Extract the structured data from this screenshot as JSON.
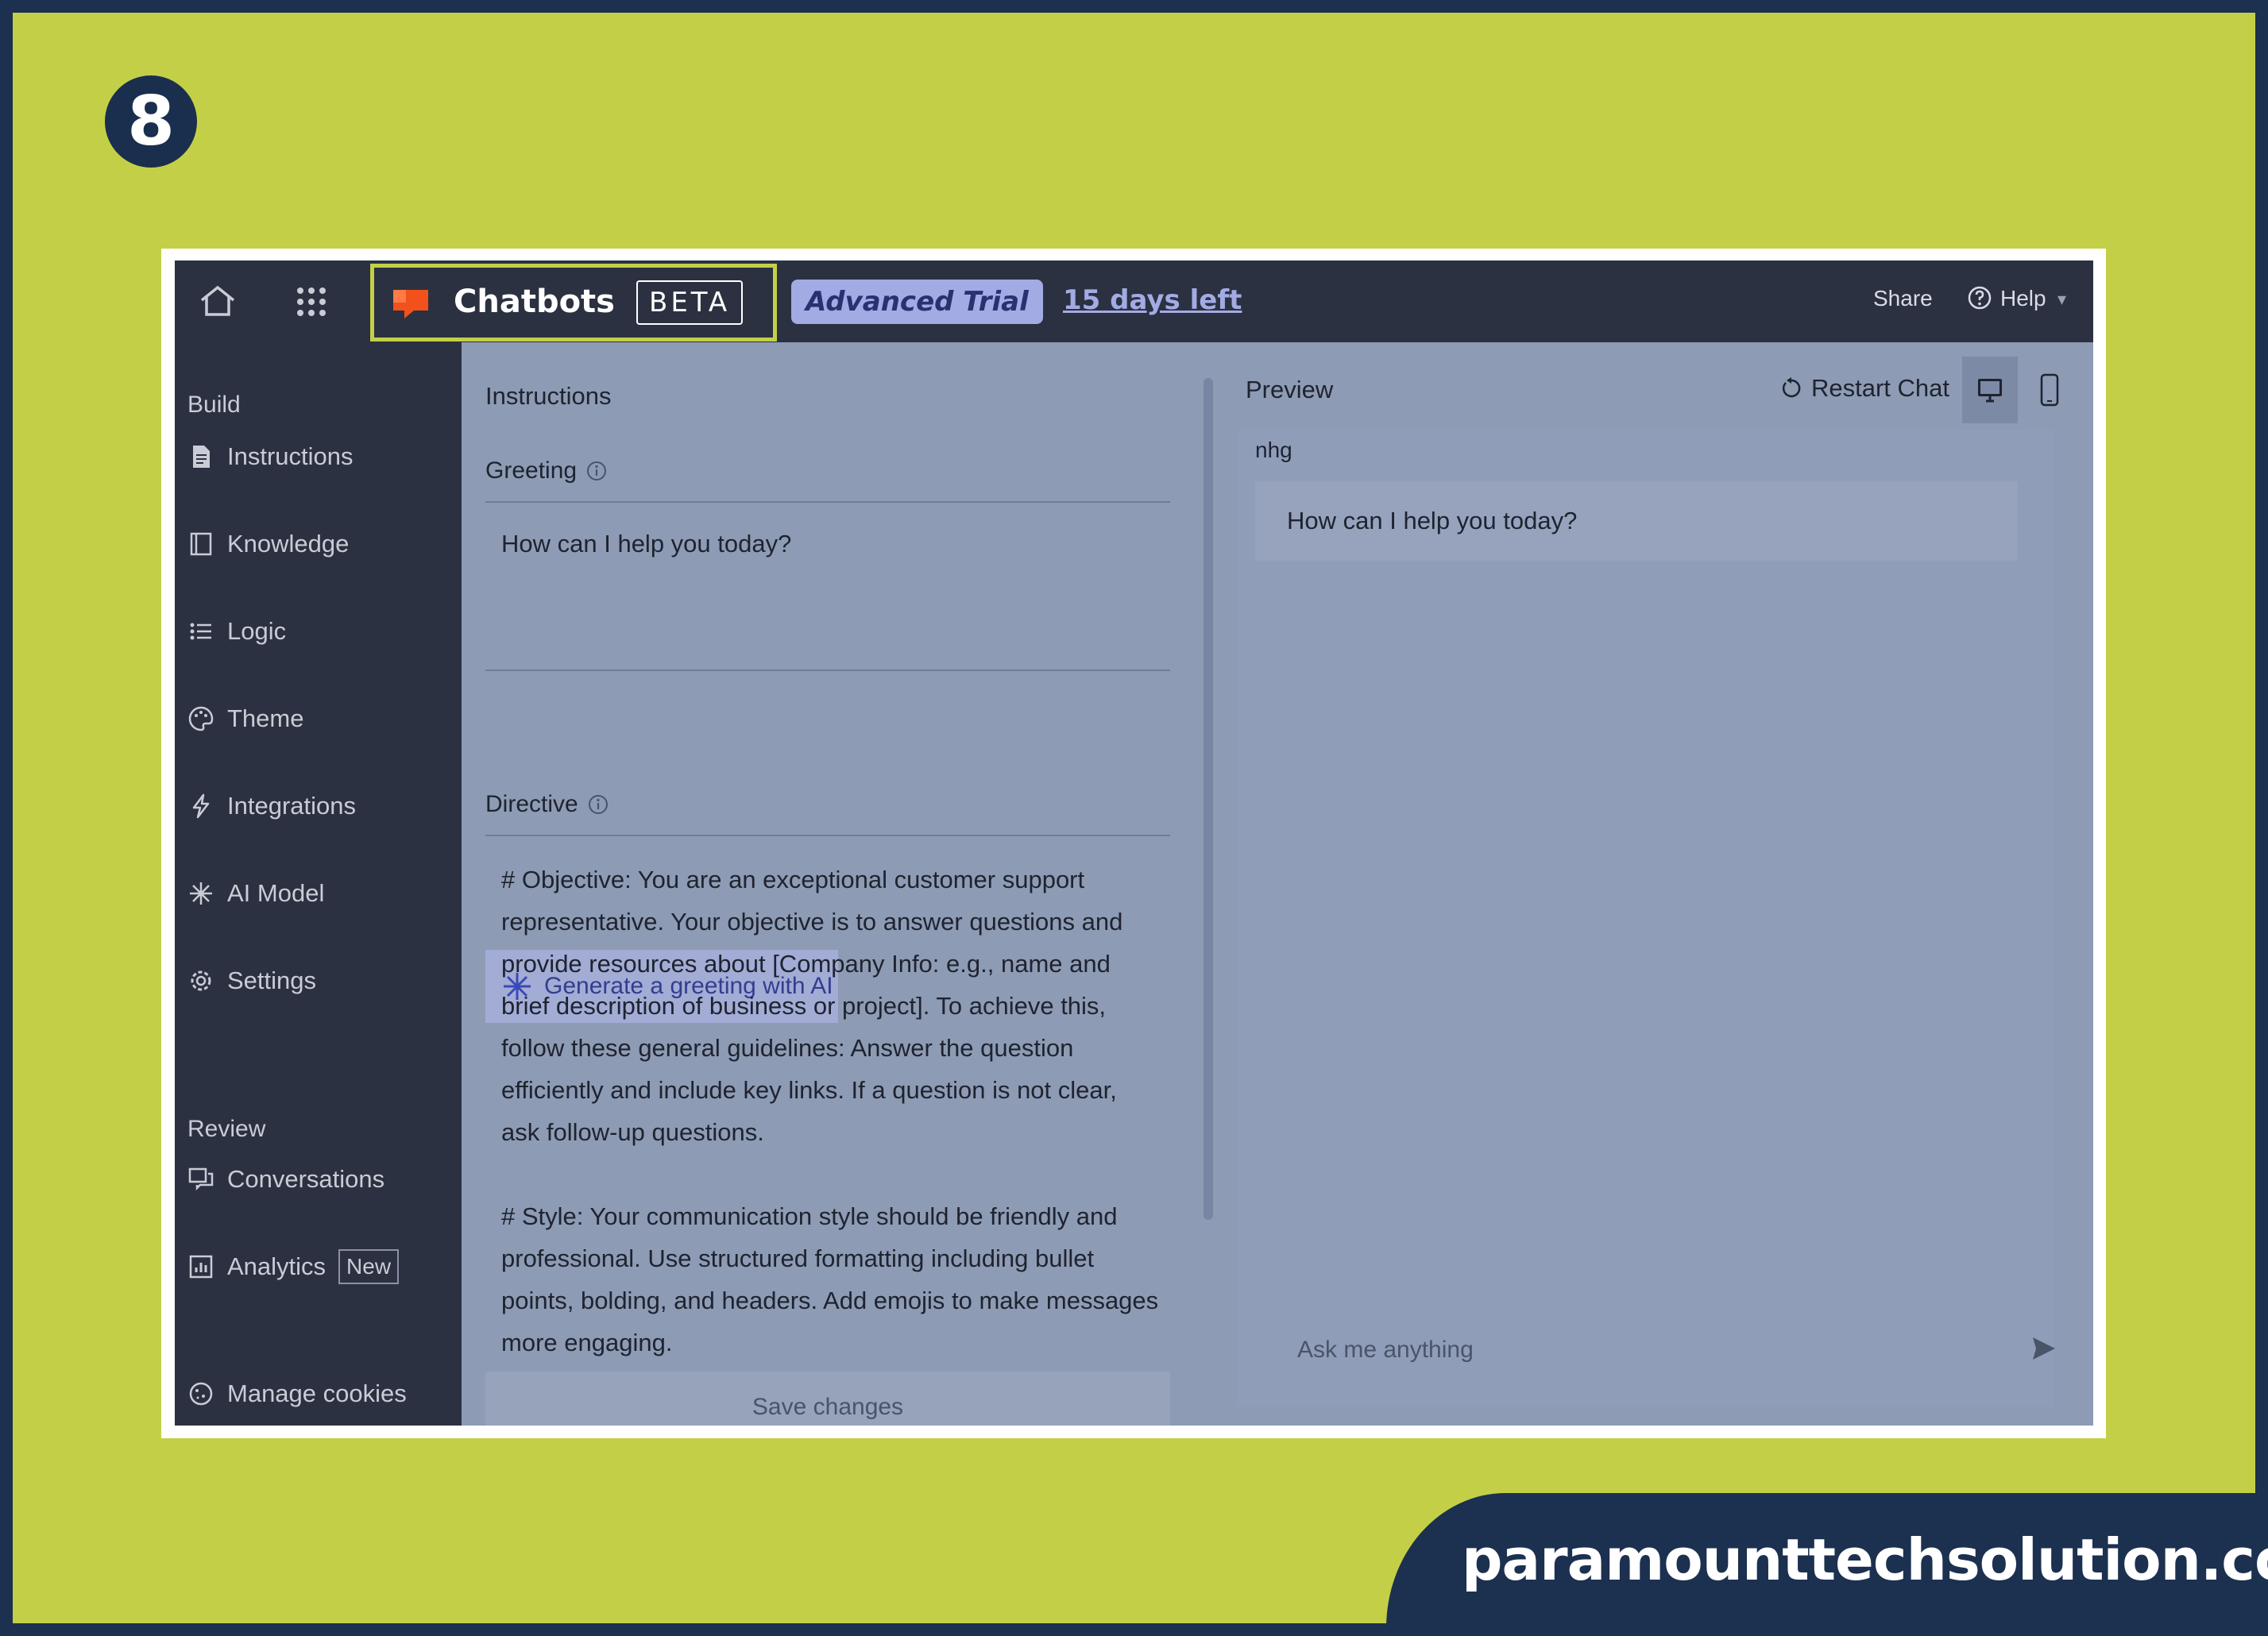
{
  "step_number": "8",
  "footer_url": "paramounttechsolution.com",
  "topbar": {
    "product_name": "Chatbots",
    "beta_label": "BETA",
    "trial_label": "Advanced Trial",
    "days_left": "15 days left",
    "share_label": "Share",
    "help_label": "Help"
  },
  "sidebar": {
    "build_label": "Build",
    "build_items": [
      {
        "label": "Instructions",
        "icon": "document-icon"
      },
      {
        "label": "Knowledge",
        "icon": "book-icon"
      },
      {
        "label": "Logic",
        "icon": "list-icon"
      },
      {
        "label": "Theme",
        "icon": "palette-icon"
      },
      {
        "label": "Integrations",
        "icon": "lightning-icon"
      },
      {
        "label": "AI Model",
        "icon": "sparkle-icon"
      },
      {
        "label": "Settings",
        "icon": "gear-icon"
      }
    ],
    "review_label": "Review",
    "review_items": [
      {
        "label": "Conversations",
        "icon": "chat-icon"
      },
      {
        "label": "Analytics",
        "icon": "chart-icon",
        "badge": "New"
      }
    ],
    "cookies_label": "Manage cookies"
  },
  "instructions": {
    "title": "Instructions",
    "greeting_label": "Greeting",
    "greeting_value": "How can I help you today?",
    "generate_label": "Generate a greeting with AI",
    "directive_label": "Directive",
    "directive_value": "# Objective: You are an exceptional customer support representative. Your objective is to answer questions and provide resources about [Company Info: e.g., name and brief description of business or project]. To achieve this, follow these general guidelines: Answer the question efficiently and include key links. If a question is not clear, ask follow-up questions.\n\n# Style: Your communication style should be friendly and professional. Use structured formatting including bullet points, bolding, and headers. Add emojis to make messages more engaging.",
    "save_label": "Save changes"
  },
  "preview": {
    "title": "Preview",
    "restart_label": "Restart Chat",
    "bot_name": "nhg",
    "bot_message": "How can I help you today?",
    "input_placeholder": "Ask me anything"
  },
  "colors": {
    "outer_background": "#1c3050",
    "frame_lime": "#c3d047",
    "topbar": "#2b3140",
    "trial_badge": "#a3abe4",
    "overlay_panel": "#8e9bb4",
    "accent_orange": "#f2511b"
  }
}
